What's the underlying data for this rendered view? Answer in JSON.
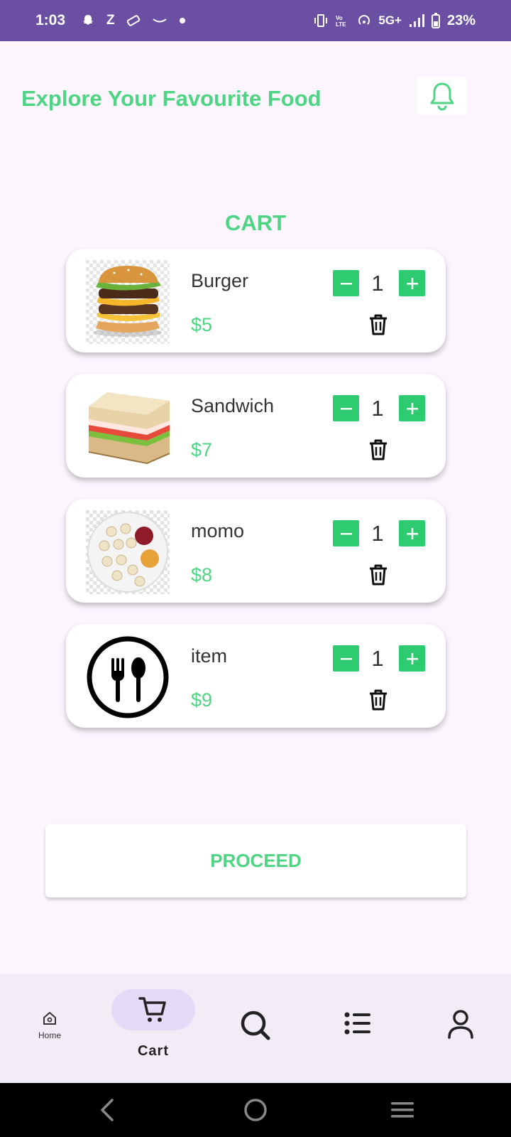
{
  "status_bar": {
    "time": "1:03",
    "left_icons": [
      "snapchat-icon",
      "Z",
      "ticket-icon",
      "amazon-icon",
      "dot-icon"
    ],
    "z_label": "Z",
    "network": "5G+",
    "battery": "23%"
  },
  "header": {
    "title": "Explore Your Favourite Food",
    "notification_icon": "bell-icon"
  },
  "cart": {
    "heading": "CART",
    "items": [
      {
        "name": "Burger",
        "price": "$5",
        "quantity": "1",
        "image": "burger-image"
      },
      {
        "name": "Sandwich",
        "price": "$7",
        "quantity": "1",
        "image": "sandwich-image"
      },
      {
        "name": "momo",
        "price": "$8",
        "quantity": "1",
        "image": "momo-image"
      },
      {
        "name": "item",
        "price": "$9",
        "quantity": "1",
        "image": "fork-spoon-icon"
      }
    ]
  },
  "proceed_label": "PROCEED",
  "bottom_nav": {
    "items": [
      {
        "label": "Home",
        "icon": "home-icon"
      },
      {
        "label": "Cart",
        "icon": "cart-icon",
        "selected": true
      },
      {
        "label": "",
        "icon": "search-icon"
      },
      {
        "label": "",
        "icon": "list-icon"
      },
      {
        "label": "",
        "icon": "person-icon"
      }
    ]
  },
  "colors": {
    "accent": "#4ed584",
    "button_green": "#2ecc71",
    "status_bar": "#6a4fa3",
    "background": "#fcf5fe"
  }
}
